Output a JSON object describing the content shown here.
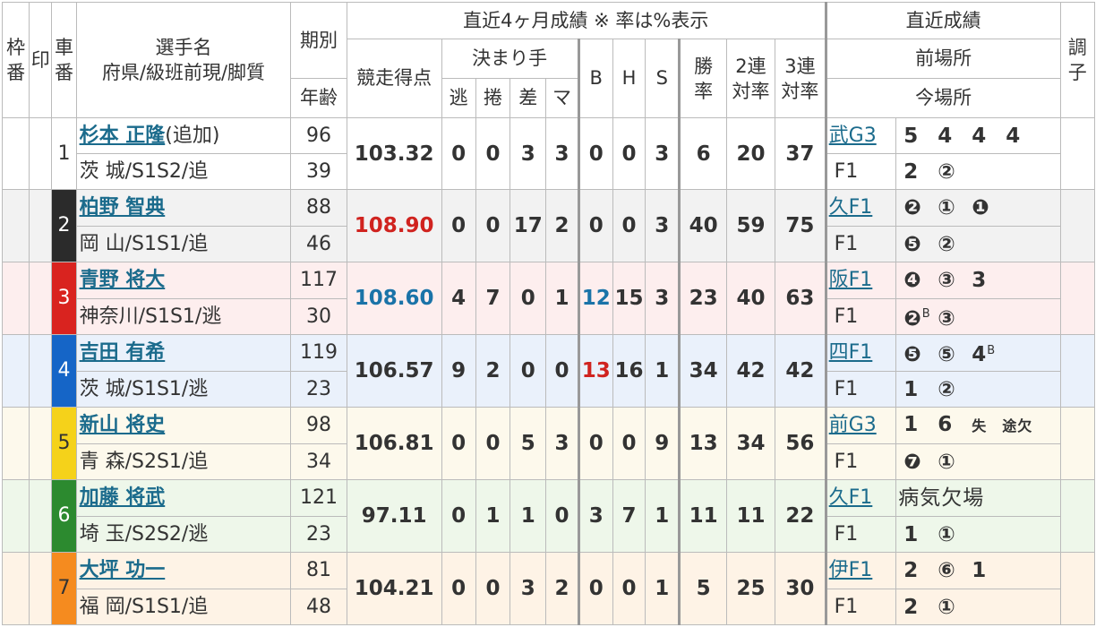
{
  "header": {
    "waku": "枠番",
    "mark": "印",
    "sha": "車番",
    "player_name": "選手名",
    "player_sub": "府県/級班前現/脚質",
    "period": "期別",
    "age": "年齢",
    "recent_title": "直近4ヶ月成績 ※ 率は%表示",
    "score": "競走得点",
    "kimarite": "決まり手",
    "nige": "逃",
    "makuri": "捲",
    "sashi": "差",
    "mark_k": "マ",
    "b": "B",
    "h": "H",
    "s": "S",
    "win_a": "勝",
    "win_b": "率",
    "two_a": "2連",
    "two_b": "対率",
    "three_a": "3連",
    "three_b": "対率",
    "recent_results": "直近成績",
    "prev_venue": "前場所",
    "cur_venue": "今場所",
    "condition": "調子"
  },
  "colors": {
    "row_bg": [
      "#ffffff",
      "#f2f2f2",
      "#fdeeee",
      "#eaf1fb",
      "#fdf9ec",
      "#eef7ea",
      "#fef3e6"
    ],
    "car_bg": [
      "#ffffff",
      "#2b2b2b",
      "#d9231f",
      "#1565c7",
      "#f5d21a",
      "#2c8a2f",
      "#f58b1f"
    ],
    "car_fg": [
      "#333333",
      "#ffffff",
      "#ffffff",
      "#ffffff",
      "#333333",
      "#ffffff",
      "#333333"
    ]
  },
  "riders": [
    {
      "car": "1",
      "name": "杉本 正隆",
      "tag": "(追加)",
      "pref": "茨 城/S1S2/追",
      "period": "96",
      "age": "39",
      "score": "103.32",
      "score_color": "",
      "nige": "0",
      "makuri": "0",
      "sashi": "3",
      "mark": "3",
      "b": "0",
      "b_color": "",
      "h": "0",
      "s": "3",
      "win": "6",
      "two": "20",
      "three": "37",
      "prev_venue": "武G3",
      "prev_results": [
        {
          "v": "5"
        },
        {
          "v": "4"
        },
        {
          "v": "4"
        },
        {
          "v": "4"
        }
      ],
      "cur_venue": "F1",
      "cur_results": [
        {
          "v": "2"
        },
        {
          "v": "②"
        }
      ]
    },
    {
      "car": "2",
      "name": "柏野 智典",
      "tag": "",
      "pref": "岡 山/S1S1/追",
      "period": "88",
      "age": "46",
      "score": "108.90",
      "score_color": "red",
      "nige": "0",
      "makuri": "0",
      "sashi": "17",
      "mark": "2",
      "b": "0",
      "b_color": "",
      "h": "0",
      "s": "3",
      "win": "40",
      "two": "59",
      "three": "75",
      "prev_venue": "久F1",
      "prev_results": [
        {
          "v": "❷"
        },
        {
          "v": "①"
        },
        {
          "v": "❶"
        }
      ],
      "cur_venue": "F1",
      "cur_results": [
        {
          "v": "❺"
        },
        {
          "v": "②"
        }
      ]
    },
    {
      "car": "3",
      "name": "青野 将大",
      "tag": "",
      "pref": "神奈川/S1S1/逃",
      "period": "117",
      "age": "30",
      "score": "108.60",
      "score_color": "blue",
      "nige": "4",
      "makuri": "7",
      "sashi": "0",
      "mark": "1",
      "b": "12",
      "b_color": "blue",
      "h": "15",
      "s": "3",
      "win": "23",
      "two": "40",
      "three": "63",
      "prev_venue": "阪F1",
      "prev_results": [
        {
          "v": "❹"
        },
        {
          "v": "③"
        },
        {
          "v": "3"
        }
      ],
      "cur_venue": "F1",
      "cur_results": [
        {
          "v": "❷",
          "sup": "B"
        },
        {
          "v": "③"
        }
      ]
    },
    {
      "car": "4",
      "name": "吉田 有希",
      "tag": "",
      "pref": "茨 城/S1S1/逃",
      "period": "119",
      "age": "23",
      "score": "106.57",
      "score_color": "",
      "nige": "9",
      "makuri": "2",
      "sashi": "0",
      "mark": "0",
      "b": "13",
      "b_color": "red",
      "h": "16",
      "s": "1",
      "win": "34",
      "two": "42",
      "three": "42",
      "prev_venue": "四F1",
      "prev_results": [
        {
          "v": "❺"
        },
        {
          "v": "⑤"
        },
        {
          "v": "4",
          "sup": "B"
        }
      ],
      "cur_venue": "F1",
      "cur_results": [
        {
          "v": "1"
        },
        {
          "v": "②"
        }
      ]
    },
    {
      "car": "5",
      "name": "新山 将史",
      "tag": "",
      "pref": "青 森/S2S1/追",
      "period": "98",
      "age": "34",
      "score": "106.81",
      "score_color": "",
      "nige": "0",
      "makuri": "0",
      "sashi": "5",
      "mark": "3",
      "b": "0",
      "b_color": "",
      "h": "0",
      "s": "9",
      "win": "13",
      "two": "34",
      "three": "56",
      "prev_venue": "前G3",
      "prev_results": [
        {
          "v": "1"
        },
        {
          "v": "6"
        },
        {
          "v": "失",
          "small": true
        },
        {
          "v": "途欠",
          "small": true
        }
      ],
      "cur_venue": "F1",
      "cur_results": [
        {
          "v": "❼"
        },
        {
          "v": "①"
        }
      ]
    },
    {
      "car": "6",
      "name": "加藤 将武",
      "tag": "",
      "pref": "埼 玉/S2S2/逃",
      "period": "121",
      "age": "23",
      "score": "97.11",
      "score_color": "",
      "nige": "0",
      "makuri": "1",
      "sashi": "1",
      "mark": "0",
      "b": "3",
      "b_color": "",
      "h": "7",
      "s": "1",
      "win": "11",
      "two": "11",
      "three": "22",
      "prev_venue": "久F1",
      "prev_results": [],
      "prev_note": "病気欠場",
      "cur_venue": "F1",
      "cur_results": [
        {
          "v": "1"
        },
        {
          "v": "①"
        }
      ]
    },
    {
      "car": "7",
      "name": "大坪 功一",
      "tag": "",
      "pref": "福 岡/S1S1/追",
      "period": "81",
      "age": "48",
      "score": "104.21",
      "score_color": "",
      "nige": "0",
      "makuri": "0",
      "sashi": "3",
      "mark": "2",
      "b": "0",
      "b_color": "",
      "h": "0",
      "s": "1",
      "win": "5",
      "two": "25",
      "three": "30",
      "prev_venue": "伊F1",
      "prev_results": [
        {
          "v": "2"
        },
        {
          "v": "⑥"
        },
        {
          "v": "1"
        }
      ],
      "cur_venue": "F1",
      "cur_results": [
        {
          "v": "2"
        },
        {
          "v": "①"
        }
      ]
    }
  ]
}
